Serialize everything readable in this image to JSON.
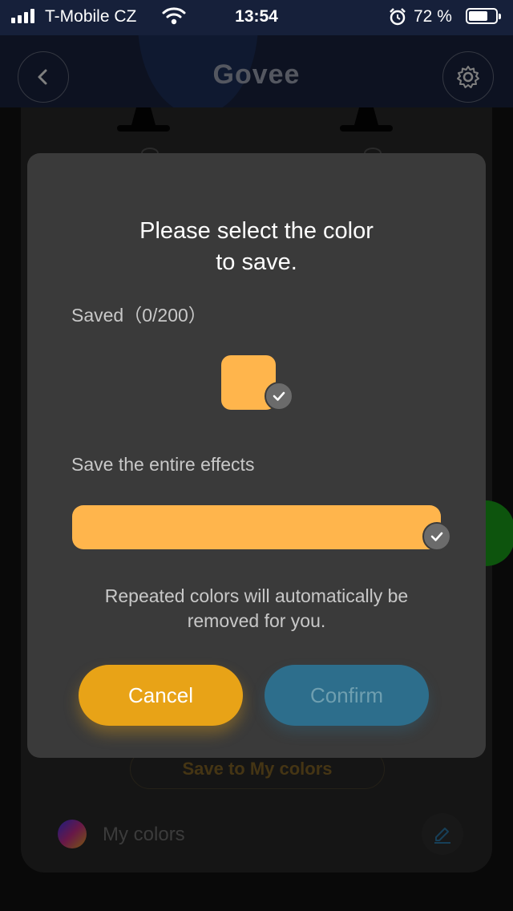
{
  "status_bar": {
    "carrier": "T-Mobile CZ",
    "time": "13:54",
    "battery_percent": "72 %",
    "battery_level": 0.72,
    "icons": [
      "signal-icon",
      "wifi-icon",
      "alarm-icon",
      "battery-icon"
    ]
  },
  "header": {
    "brand": "Govee",
    "icons": [
      "back-arrow-icon",
      "gear-icon"
    ]
  },
  "background": {
    "save_to_my_colors": "Save to My colors",
    "my_colors_label": "My colors",
    "icons": [
      "lamp-icon",
      "pencil-icon"
    ]
  },
  "dialog": {
    "title_line1": "Please select the color",
    "title_line2": "to save.",
    "saved_count": "Saved（0/200）",
    "effects_label": "Save the entire effects",
    "note_line1": "Repeated colors will automatically be",
    "note_line2": "removed for you.",
    "cancel_label": "Cancel",
    "confirm_label": "Confirm",
    "icons": [
      "check-icon"
    ]
  },
  "colors": {
    "swatch": "#ffb54c",
    "cancel": "#e8a317",
    "confirm": "#2d6e8c",
    "dialog_bg": "#3a3a3a"
  }
}
